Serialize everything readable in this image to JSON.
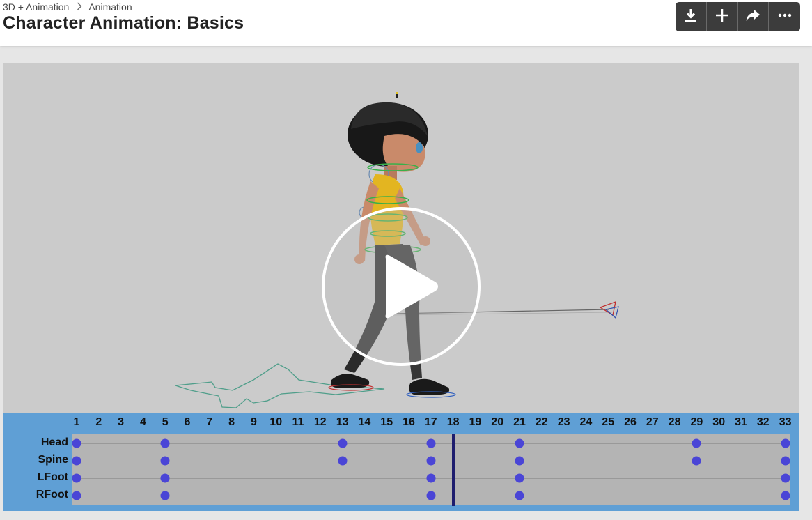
{
  "breadcrumb": {
    "parent": "3D + Animation",
    "current": "Animation"
  },
  "page_title": "Character Animation: Basics",
  "toolbar": {
    "icons": [
      "download-icon",
      "plus-icon",
      "share-icon",
      "more-icon"
    ]
  },
  "colors": {
    "timeline_bg": "#5f9fd5",
    "keyframe": "#4a45d6",
    "playhead": "#1e1d6e",
    "track_bg": "#b4b4b4"
  },
  "timeline": {
    "frames": [
      "1",
      "2",
      "3",
      "4",
      "5",
      "6",
      "7",
      "8",
      "9",
      "10",
      "11",
      "12",
      "13",
      "14",
      "15",
      "16",
      "17",
      "18",
      "19",
      "20",
      "21",
      "22",
      "23",
      "24",
      "25",
      "26",
      "27",
      "28",
      "29",
      "30",
      "31",
      "32",
      "33"
    ],
    "current_frame": 18,
    "tracks": [
      {
        "name": "Head",
        "keys": [
          1,
          5,
          13,
          17,
          21,
          29,
          33
        ]
      },
      {
        "name": "Spine",
        "keys": [
          1,
          5,
          13,
          17,
          21,
          29,
          33
        ]
      },
      {
        "name": "LFoot",
        "keys": [
          1,
          5,
          17,
          21,
          33
        ]
      },
      {
        "name": "RFoot",
        "keys": [
          1,
          5,
          17,
          21,
          33
        ]
      }
    ]
  }
}
